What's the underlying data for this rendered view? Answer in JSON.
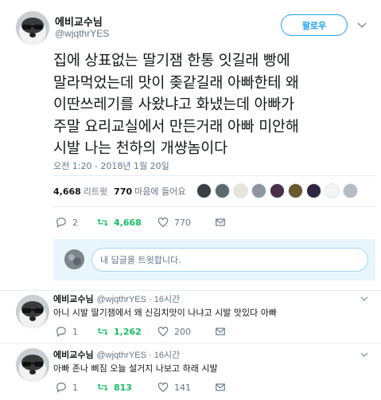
{
  "tweet": {
    "author_name": "에비교수님",
    "author_handle": "@wjqthrYES",
    "follow_label": "팔로우",
    "text": "집에 상표없는 딸기잼 한통 잇길래 빵에\n말라먹었는데 맛이 좆같길래 아빠한테 왜\n이딴쓰레기를 사왔냐고 화냈는데 아빠가\n주말 요리교실에서 만든거래 아빠 미안해\n시발 나는 천하의 개썅놈이다",
    "timestamp": "오전 1:20 - 2018년 1월 20일",
    "retweets_count": "4,668",
    "retweets_label": "리트윗",
    "likes_count": "770",
    "likes_label": "마음에 들어요",
    "actions": {
      "replies": "2",
      "retweets": "4,668",
      "likes": "770"
    }
  },
  "reply_box": {
    "placeholder": "내 답글을 트윗합니다."
  },
  "replies": [
    {
      "name": "에비교수님",
      "handle": "@wjqthrYES · 16시간",
      "text": "아니 시발 딸기잼에서 왜 신김치맛이 나냐고 시발 맛있다 아빠",
      "replies": "1",
      "retweets": "1,262",
      "likes": "200"
    },
    {
      "name": "에비교수님",
      "handle": "@wjqthrYES · 16시간",
      "text": "아빠 존나 삐짐 오늘 설거지 나보고 하래 시발",
      "replies": "1",
      "retweets": "813",
      "likes": "141"
    }
  ],
  "colors": {
    "accent": "#1da1f2",
    "retweet_green": "#17bf63",
    "secondary_text": "#657786"
  },
  "icons": [
    "reply-icon",
    "retweet-icon",
    "heart-icon",
    "mail-icon",
    "chevron-down-icon"
  ]
}
